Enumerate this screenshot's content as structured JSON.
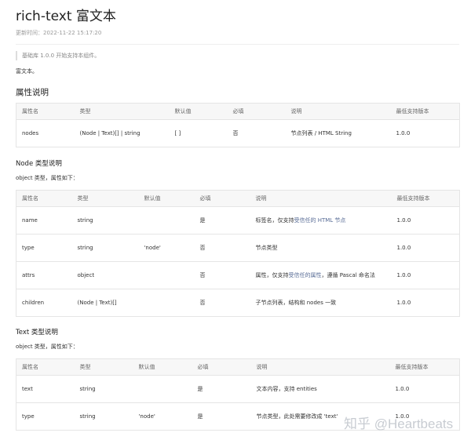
{
  "title": "rich-text 富文本",
  "updated": "更新时间：2022-11-22 15:17:20",
  "note": "基础库 1.0.0 开始支持本组件。",
  "description": "富文本。",
  "attrs_section": {
    "heading": "属性说明",
    "headers": [
      "属性名",
      "类型",
      "默认值",
      "必填",
      "说明",
      "最低支持版本"
    ],
    "rows": [
      {
        "name": "nodes",
        "type": "(Node | Text)[] | string",
        "default": "[ ]",
        "required": "否",
        "desc": "节点列表 / HTML String",
        "version": "1.0.0"
      }
    ]
  },
  "node_section": {
    "heading": "Node 类型说明",
    "subheading": "object 类型，属性如下：",
    "headers": [
      "属性名",
      "类型",
      "默认值",
      "必填",
      "说明",
      "最低支持版本"
    ],
    "rows": [
      {
        "name": "name",
        "type": "string",
        "default": "",
        "required": "是",
        "desc_pre": "标签名，仅支持",
        "desc_link": "受信任的 HTML 节点",
        "desc_post": "",
        "version": "1.0.0"
      },
      {
        "name": "type",
        "type": "string",
        "default": "'node'",
        "required": "否",
        "desc_pre": "节点类型",
        "desc_link": "",
        "desc_post": "",
        "version": "1.0.0"
      },
      {
        "name": "attrs",
        "type": "object",
        "default": "",
        "required": "否",
        "desc_pre": "属性，仅支持",
        "desc_link": "受信任的属性",
        "desc_post": "，遵循 Pascal 命名法",
        "version": "1.0.0"
      },
      {
        "name": "children",
        "type": "(Node | Text)[]",
        "default": "",
        "required": "否",
        "desc_pre": "子节点列表，结构和 nodes 一致",
        "desc_link": "",
        "desc_post": "",
        "version": "1.0.0"
      }
    ]
  },
  "text_section": {
    "heading": "Text 类型说明",
    "subheading": "object 类型，属性如下：",
    "headers": [
      "属性名",
      "类型",
      "默认值",
      "必填",
      "说明",
      "最低支持版本"
    ],
    "rows": [
      {
        "name": "text",
        "type": "string",
        "default": "",
        "required": "是",
        "desc": "文本内容，支持 entities",
        "version": "1.0.0"
      },
      {
        "name": "type",
        "type": "string",
        "default": "'node'",
        "required": "是",
        "desc": "节点类型，此处需要修改成 'text'",
        "version": "1.0.0"
      }
    ]
  },
  "watermark": "知乎 @Heartbeats",
  "colors": {
    "link": "#576b95",
    "border": "#e5e5e5",
    "header_bg": "#f7f7f7"
  }
}
